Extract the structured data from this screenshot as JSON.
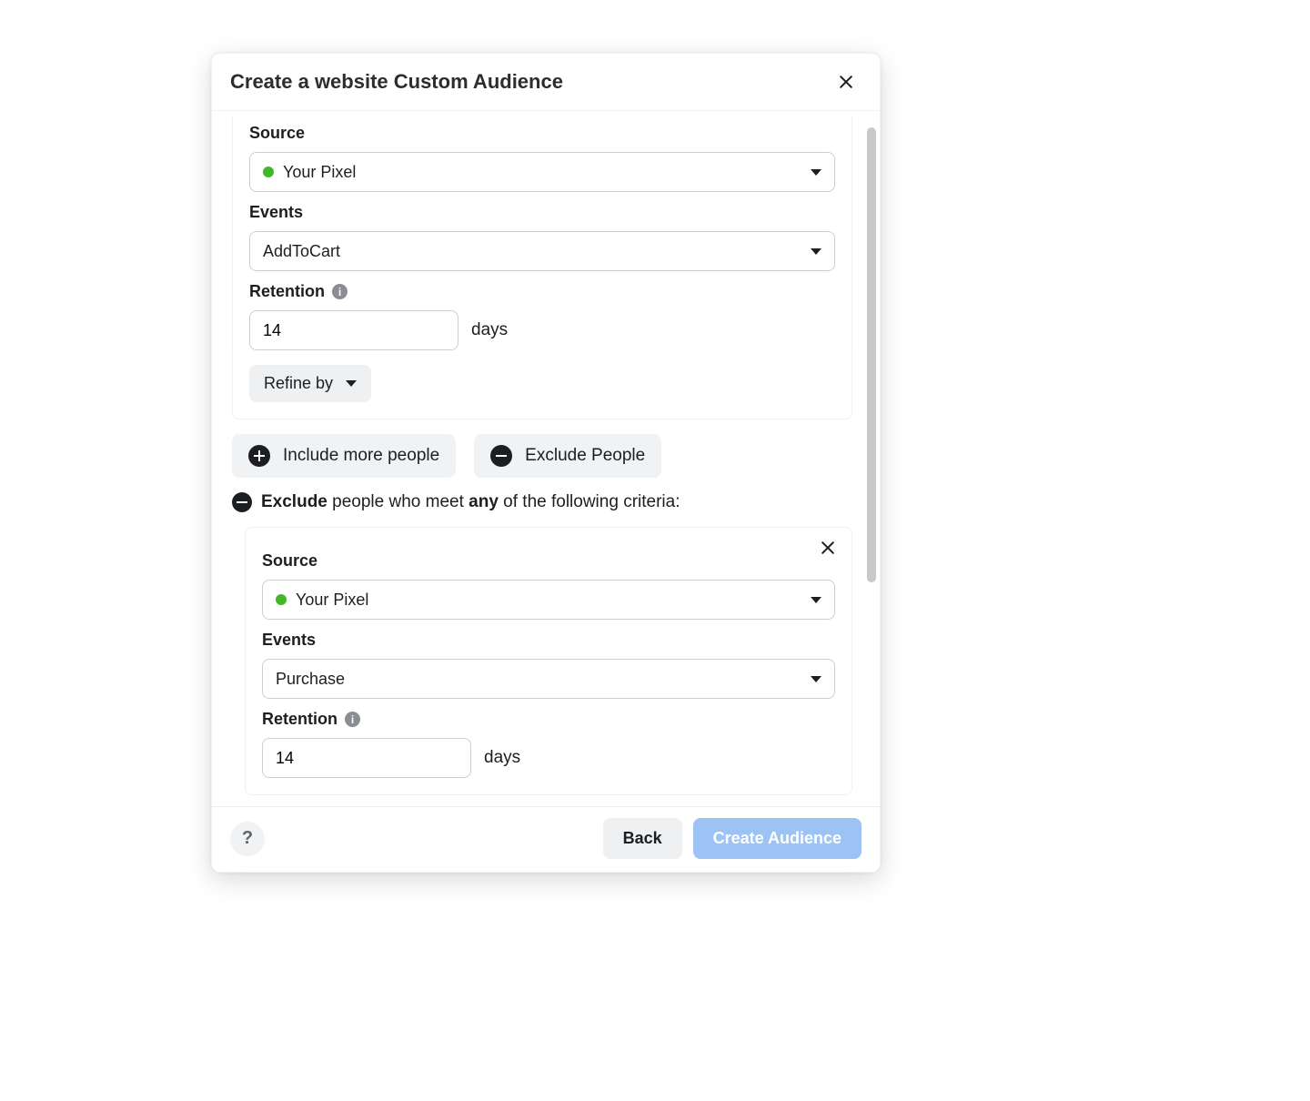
{
  "modal": {
    "title": "Create a website Custom Audience"
  },
  "include": {
    "source_label": "Source",
    "source_value": "Your Pixel",
    "events_label": "Events",
    "events_value": "AddToCart",
    "retention_label": "Retention",
    "retention_value": "14",
    "days_label": "days",
    "refine_label": "Refine by"
  },
  "actions": {
    "include_more": "Include more people",
    "exclude_people": "Exclude People"
  },
  "exclude_text": {
    "prefix": "Exclude",
    "middle": " people who meet ",
    "any": "any",
    "suffix": " of the following criteria:"
  },
  "exclude": {
    "source_label": "Source",
    "source_value": "Your Pixel",
    "events_label": "Events",
    "events_value": "Purchase",
    "retention_label": "Retention",
    "retention_value": "14",
    "days_label": "days"
  },
  "footer": {
    "back": "Back",
    "create": "Create Audience"
  }
}
